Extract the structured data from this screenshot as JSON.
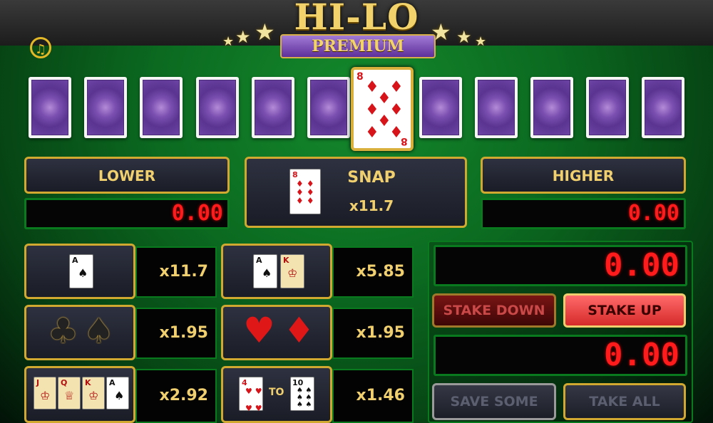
{
  "logo": {
    "title": "HI-LO",
    "subtitle": "PREMIUM"
  },
  "current_card": {
    "rank": "8",
    "suit": "diamonds"
  },
  "bets": {
    "lower": {
      "label": "LOWER",
      "amount": "0.00"
    },
    "snap": {
      "label": "SNAP",
      "multiplier": "x11.7"
    },
    "higher": {
      "label": "HIGHER",
      "amount": "0.00"
    }
  },
  "side_bets": {
    "single_card": {
      "multiplier": "x11.7"
    },
    "two_cards": {
      "multiplier": "x5.85"
    },
    "black": {
      "multiplier": "x1.95"
    },
    "red": {
      "multiplier": "x1.95"
    },
    "picture": {
      "multiplier": "x2.92"
    },
    "range": {
      "to_label": "TO",
      "multiplier": "x1.46"
    }
  },
  "stake": {
    "display": "0.00",
    "down_label": "STAKE DOWN",
    "up_label": "STAKE UP",
    "winnings": "0.00",
    "save_label": "SAVE SOME",
    "take_label": "TAKE ALL"
  },
  "colors": {
    "gold": "#d1a931",
    "felt": "#0b6a20",
    "led_red": "#ff1b1b",
    "stake_up": "#e23a3a"
  },
  "icons": {
    "sound": "sound-icon"
  }
}
